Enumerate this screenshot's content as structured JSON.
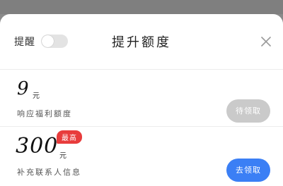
{
  "header": {
    "remind_label": "提醒",
    "toggle_on": false,
    "title": "提升额度"
  },
  "offers": [
    {
      "amount": "9",
      "unit": "元",
      "description": "响应福利额度",
      "button_label": "待领取",
      "button_color": "#cacaca",
      "enabled": false
    },
    {
      "amount": "300",
      "unit": "元",
      "badge": "最高",
      "description": "补充联系人信息",
      "button_label": "去领取",
      "button_color": "#3b7ff5",
      "enabled": true
    }
  ],
  "colors": {
    "accent": "#3b7ff5",
    "badge": "#e83c3c",
    "disabled": "#cacaca"
  },
  "icons": {
    "close": "close-icon"
  }
}
